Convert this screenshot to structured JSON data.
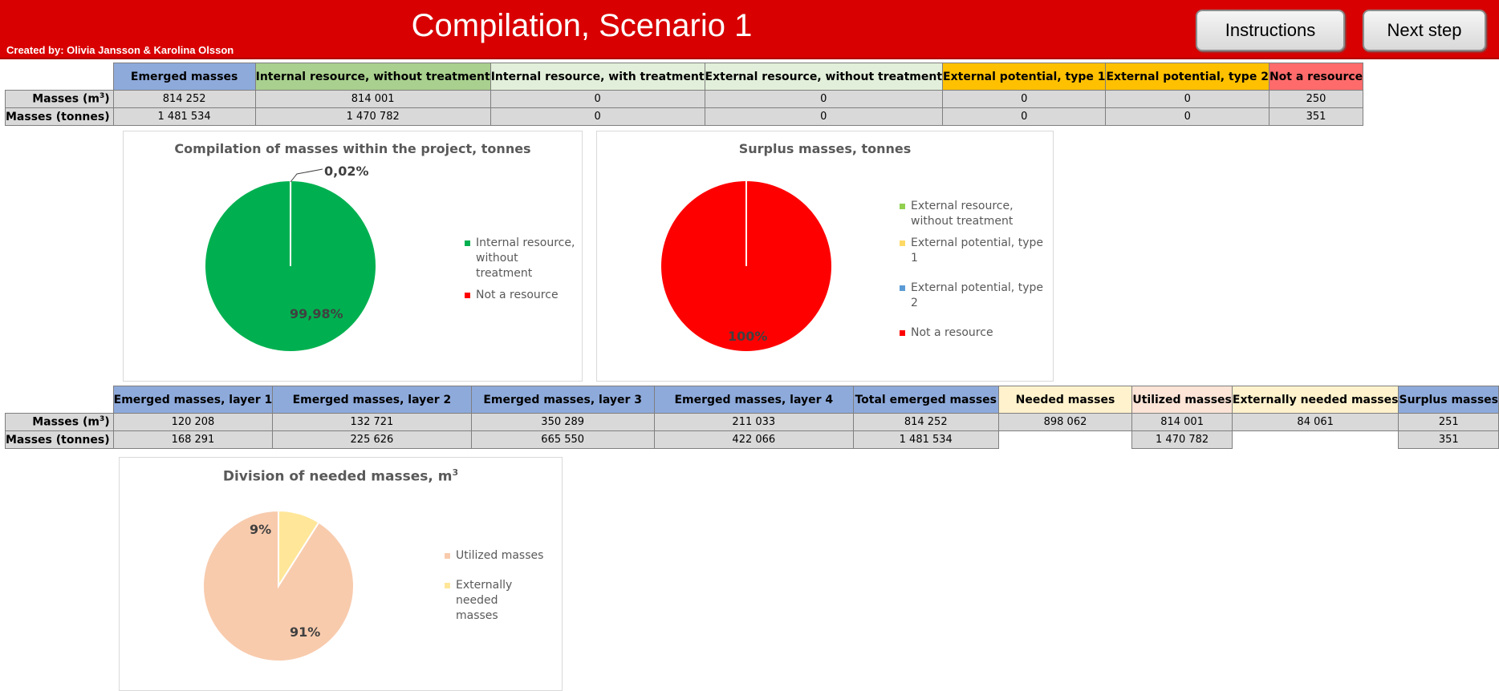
{
  "header": {
    "title": "Compilation, Scenario 1",
    "credit": "Created by: Olivia Jansson & Karolina Olsson",
    "buttons": {
      "instructions": "Instructions",
      "next": "Next step"
    }
  },
  "table1": {
    "headers": [
      "Emerged masses",
      "Internal resource, without treatment",
      "Internal resource, with treatment",
      "External resource, without treatment",
      "External potential, type 1",
      "External potential, type 2",
      "Not a resource"
    ],
    "row_labels": [
      "Masses (m",
      "Masses (tonnes)"
    ],
    "unit_sup": "3",
    "row_close": ")",
    "rows": [
      [
        "814 252",
        "814 001",
        "0",
        "0",
        "0",
        "0",
        "250"
      ],
      [
        "1 481 534",
        "1 470 782",
        "0",
        "0",
        "0",
        "0",
        "351"
      ]
    ]
  },
  "table2": {
    "headers": [
      "Emerged masses, layer 1",
      "Emerged masses, layer 2",
      "Emerged masses, layer 3",
      "Emerged masses, layer 4",
      "Total emerged masses",
      "Needed masses",
      "Utilized masses",
      "Externally needed masses",
      "Surplus masses"
    ],
    "rows": [
      [
        "120 208",
        "132 721",
        "350 289",
        "211 033",
        "814 252",
        "898 062",
        "814 001",
        "84 061",
        "251"
      ],
      [
        "168 291",
        "225 626",
        "665 550",
        "422 066",
        "1 481 534",
        "",
        "1 470 782",
        "",
        "351"
      ]
    ]
  },
  "chart_data": [
    {
      "type": "pie",
      "title": "Compilation of masses within the project, tonnes",
      "slices": [
        {
          "label": "Internal resource, without treatment",
          "value": 99.98,
          "display": "99,98%",
          "color": "#00b050"
        },
        {
          "label": "Not a resource",
          "value": 0.02,
          "display": "0,02%",
          "color": "#ff0000"
        }
      ],
      "legend_lines": [
        [
          "Internal resource,",
          "without treatment"
        ],
        [
          "Not a resource"
        ]
      ],
      "legend": "right"
    },
    {
      "type": "pie",
      "title": "Surplus masses, tonnes",
      "slices": [
        {
          "label": "External resource, without treatment",
          "value": 0,
          "color": "#92d050"
        },
        {
          "label": "External potential, type 1",
          "value": 0,
          "color": "#ffd966"
        },
        {
          "label": "External potential, type 2",
          "value": 0,
          "color": "#5b9bd5"
        },
        {
          "label": "Not a resource",
          "value": 100,
          "display": "100%",
          "color": "#ff0000"
        }
      ],
      "legend_lines": [
        [
          "External resource,",
          "without treatment"
        ],
        [
          "External potential, type 1"
        ],
        [
          "External potential, type 2"
        ],
        [
          "Not a resource"
        ]
      ],
      "legend": "right"
    },
    {
      "type": "pie",
      "title": "Division of needed masses, m",
      "title_sup": "3",
      "slices": [
        {
          "label": "Utilized masses",
          "value": 91,
          "display": "91%",
          "color": "#f8cbad"
        },
        {
          "label": "Externally needed masses",
          "value": 9,
          "display": "9%",
          "color": "#ffe699"
        }
      ],
      "legend_lines": [
        [
          "Utilized masses"
        ],
        [
          "Externally needed",
          "masses"
        ]
      ],
      "legend": "right"
    }
  ]
}
